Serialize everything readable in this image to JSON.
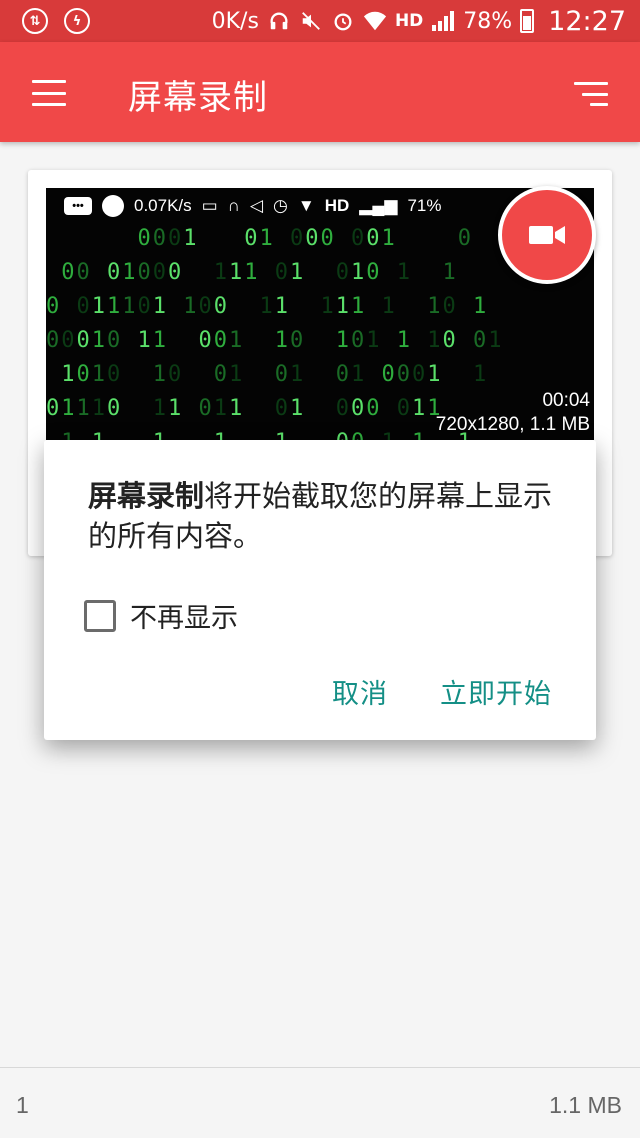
{
  "status_bar": {
    "left_icons": [
      "download-upload-icon",
      "bug-icon"
    ],
    "net_speed": "0K/s",
    "battery": "78%",
    "time": "12:27"
  },
  "app_bar": {
    "title": "屏幕录制",
    "menu_icon": "hamburger-menu-icon",
    "sort_icon": "sort-icon"
  },
  "video_card": {
    "thumb_status": {
      "net_speed": "0.07K/s",
      "battery": "71%"
    },
    "duration": "00:04",
    "resolution_size": "720x1280, 1.1 MB",
    "matrix_rows": [
      "      0001   01 000 001    0   ",
      " 00 01000  111 01  010 1  1   ",
      "0 011101 100  11  111 1  10 1 ",
      "00010 11  001  10  101 1 10 01",
      " 1010  10  01  01  01 0001  1 ",
      "01110  11 011  01  000 011    ",
      " 1 1   1   1   1   00 1 1  1  "
    ],
    "accent_color": "#f04848"
  },
  "dialog": {
    "message_bold": "屏幕录制",
    "message_rest": "将开始截取您的屏幕上显示的所有内容。",
    "checkbox_label": "不再显示",
    "checkbox_checked": false,
    "cancel_label": "取消",
    "start_label": "立即开始",
    "button_color": "#148f86"
  },
  "footer": {
    "count": "1",
    "total_size": "1.1 MB"
  }
}
